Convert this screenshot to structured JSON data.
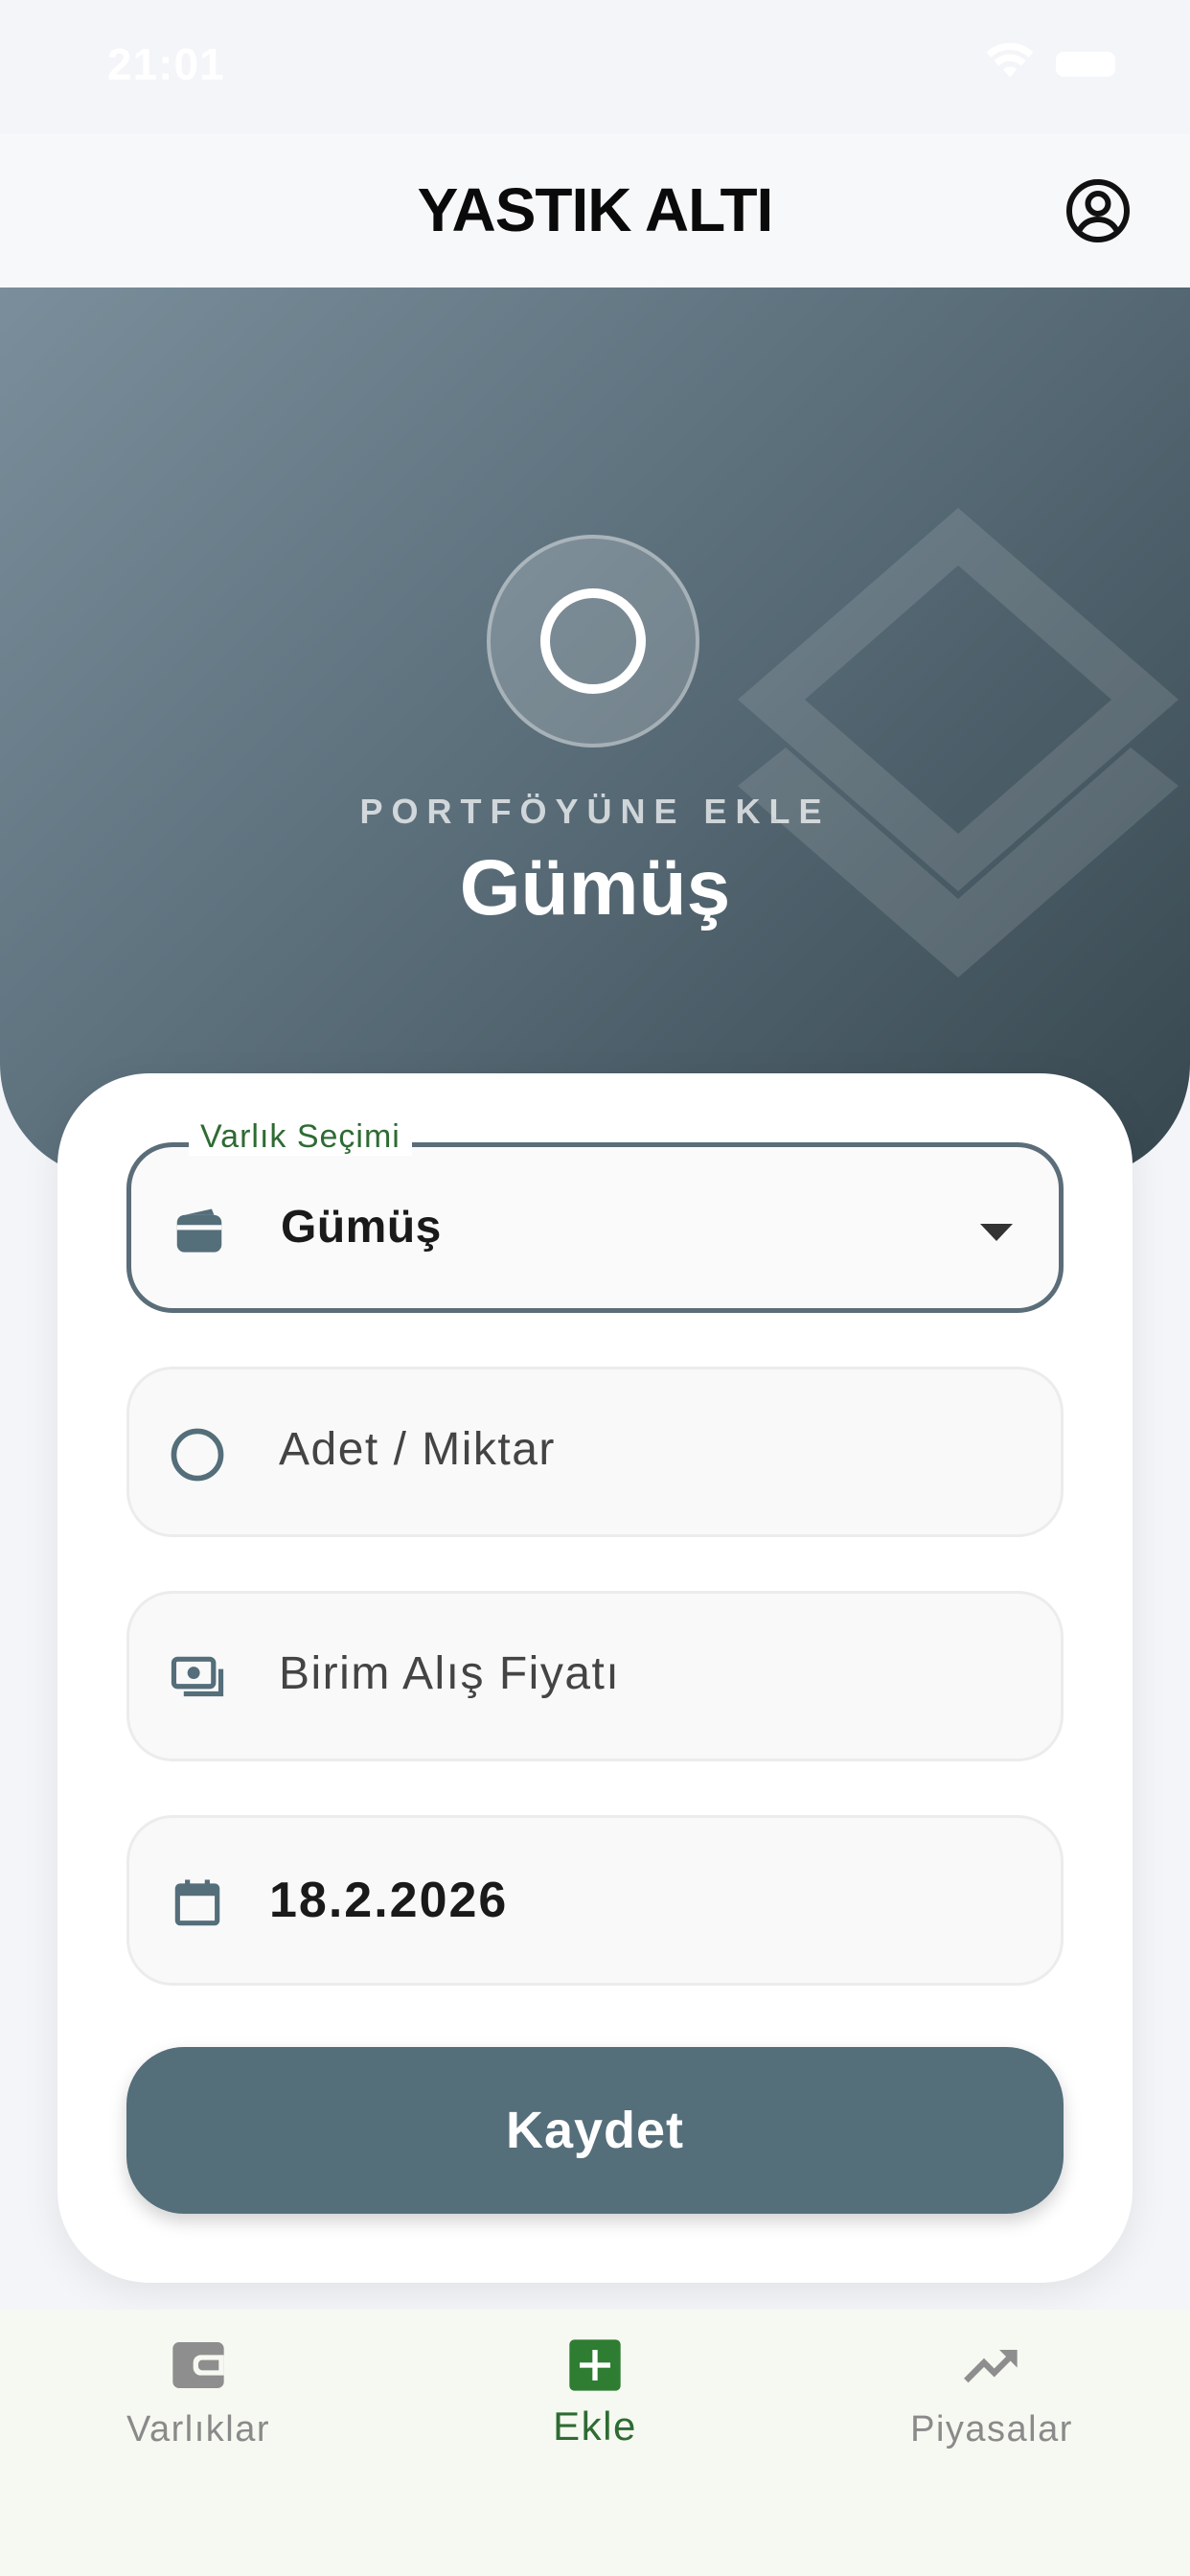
{
  "status": {
    "time": "21:01"
  },
  "app": {
    "title": "YASTIK ALTI"
  },
  "hero": {
    "kicker": "PORTFÖYÜNE EKLE",
    "asset_name": "Gümüş"
  },
  "form": {
    "asset_select": {
      "label": "Varlık Seçimi",
      "value": "Gümüş"
    },
    "quantity": {
      "placeholder": "Adet / Miktar"
    },
    "unit_price": {
      "placeholder": "Birim Alış Fiyatı"
    },
    "date": {
      "value": "18.2.2026"
    },
    "save_label": "Kaydet"
  },
  "nav": {
    "items": [
      {
        "label": "Varlıklar",
        "icon": "wallet-icon"
      },
      {
        "label": "Ekle",
        "icon": "add-box-icon"
      },
      {
        "label": "Piyasalar",
        "icon": "trending-up-icon"
      }
    ]
  },
  "colors": {
    "primary": "#546e7a",
    "accent_green": "#2e6b33",
    "hero_gradient_start": "#7a8f9b",
    "hero_gradient_end": "#37474f"
  }
}
